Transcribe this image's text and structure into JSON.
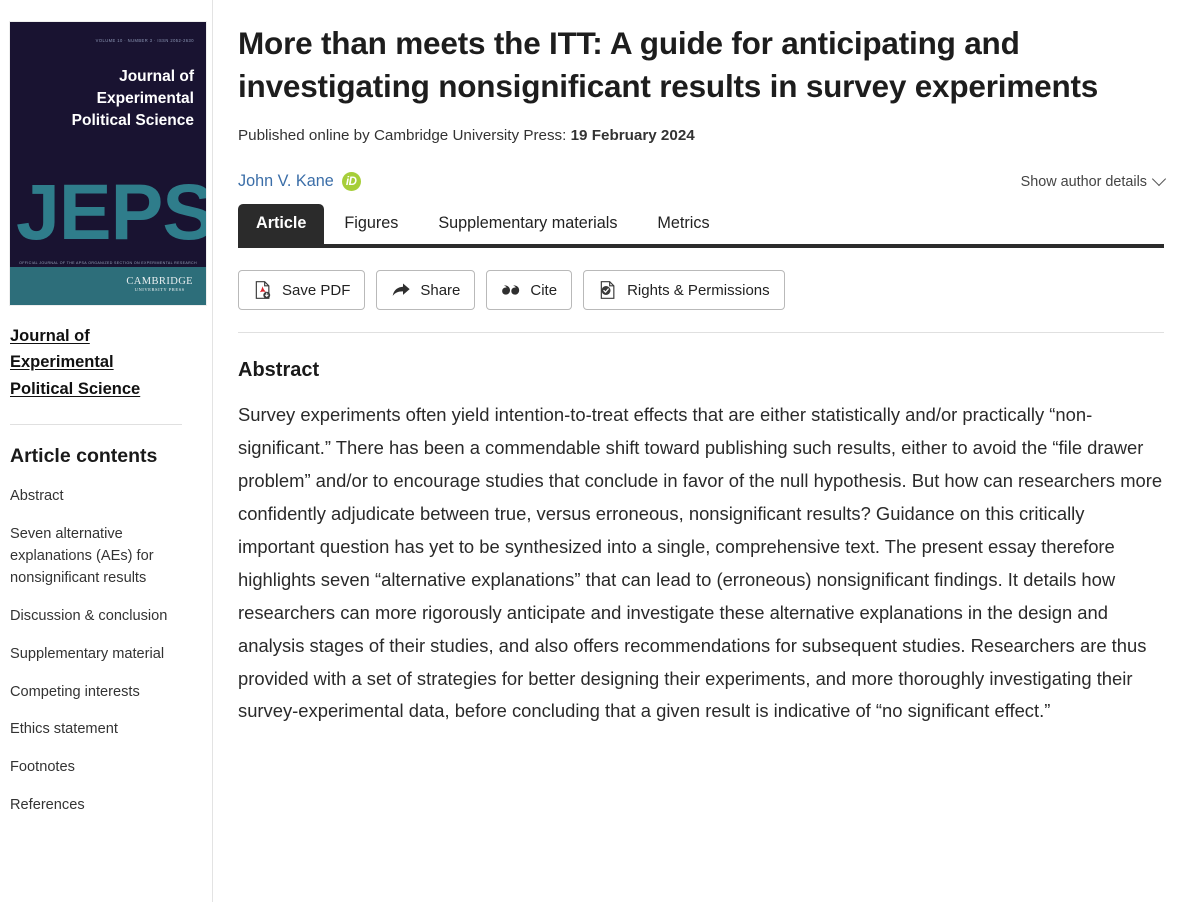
{
  "sidebar": {
    "cover": {
      "volume_line": "VOLUME 10 · NUMBER 3 · ISSN 2052-2630",
      "title_line1": "Journal of",
      "title_line2": "Experimental",
      "title_line3": "Political Science",
      "acronym": "JEPS",
      "strapline": "OFFICIAL JOURNAL OF THE APSA ORGANIZED SECTION ON EXPERIMENTAL RESEARCH",
      "publisher_line1": "CAMBRIDGE",
      "publisher_line2": "UNIVERSITY PRESS",
      "bg_color": "#191331",
      "accent_color": "#2f7d8b",
      "band_color": "#2d6e7a"
    },
    "journal_link": "Journal of Experimental Political Science",
    "contents_heading": "Article contents",
    "contents_items": [
      "Abstract",
      "Seven alternative explanations (AEs) for nonsignificant results",
      "Discussion & conclusion",
      "Supplementary material",
      "Competing interests",
      "Ethics statement",
      "Footnotes",
      "References"
    ]
  },
  "article": {
    "title": "More than meets the ITT: A guide for anticipating and investigating nonsignificant results in survey experiments",
    "published_label": "Published online by Cambridge University Press:",
    "published_date": "19 February 2024",
    "author": "John V. Kane",
    "orcid_label": "iD",
    "show_author_details": "Show author details",
    "author_link_color": "#3b6ea8",
    "orcid_color": "#a6ce39"
  },
  "tabs": [
    {
      "label": "Article",
      "active": true
    },
    {
      "label": "Figures",
      "active": false
    },
    {
      "label": "Supplementary materials",
      "active": false
    },
    {
      "label": "Metrics",
      "active": false
    }
  ],
  "actions": [
    {
      "label": "Save PDF",
      "icon": "pdf-download-icon"
    },
    {
      "label": "Share",
      "icon": "share-arrow-icon"
    },
    {
      "label": "Cite",
      "icon": "quote-marks-icon"
    },
    {
      "label": "Rights & Permissions",
      "icon": "document-check-icon"
    }
  ],
  "abstract": {
    "heading": "Abstract",
    "text": "Survey experiments often yield intention-to-treat effects that are either statistically and/or practically “non-significant.” There has been a commendable shift toward publishing such results, either to avoid the “file drawer problem” and/or to encourage studies that conclude in favor of the null hypothesis. But how can researchers more confidently adjudicate between true, versus erroneous, nonsignificant results? Guidance on this critically important question has yet to be synthesized into a single, comprehensive text. The present essay therefore highlights seven “alternative explanations” that can lead to (erroneous) nonsignificant findings. It details how researchers can more rigorously anticipate and investigate these alternative explanations in the design and analysis stages of their studies, and also offers recommendations for subsequent studies. Researchers are thus provided with a set of strategies for better designing their experiments, and more thoroughly investigating their survey-experimental data, before concluding that a given result is indicative of “no significant effect.”"
  }
}
